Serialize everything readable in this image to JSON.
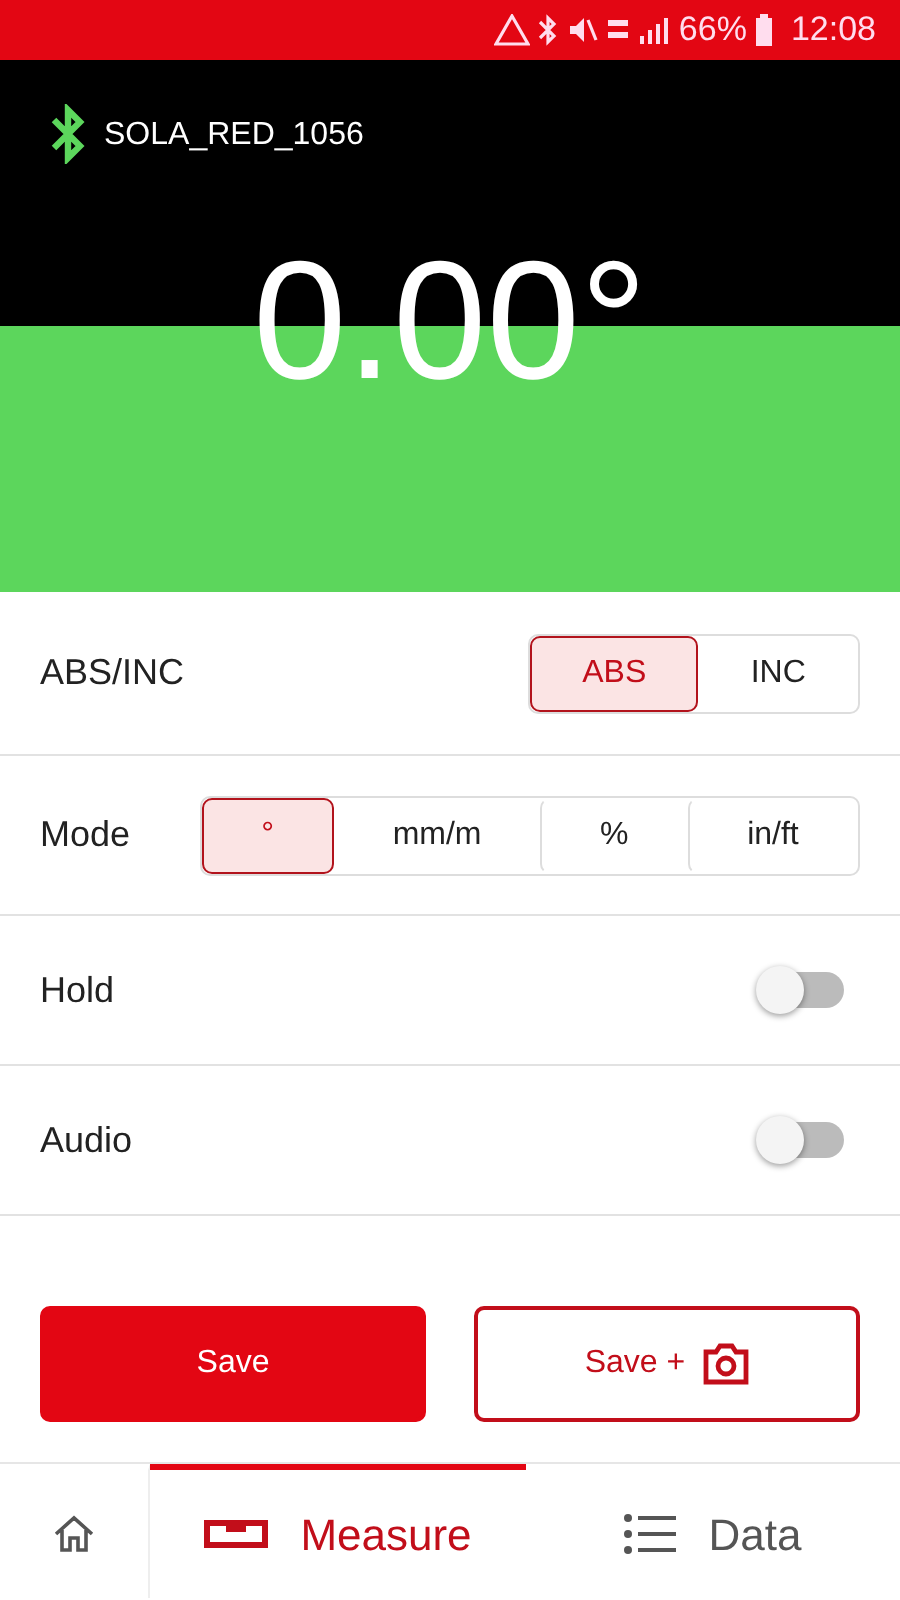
{
  "status_bar": {
    "battery": "66%",
    "time": "12:08"
  },
  "device": {
    "name": "SOLA_RED_1056",
    "connected": true
  },
  "reading": "0.00°",
  "settings": [
    {
      "kind": "segments",
      "label": "ABS/INC",
      "options": [
        {
          "label": "ABS",
          "selected": true
        },
        {
          "label": "INC",
          "selected": false
        }
      ]
    },
    {
      "kind": "segments",
      "label": "Mode",
      "options": [
        {
          "label": "°",
          "selected": true
        },
        {
          "label": "mm/m",
          "selected": false
        },
        {
          "label": "%",
          "selected": false
        },
        {
          "label": "in/ft",
          "selected": false
        }
      ]
    },
    {
      "kind": "toggle",
      "label": "Hold",
      "on": false
    },
    {
      "kind": "toggle",
      "label": "Audio",
      "on": false
    }
  ],
  "buttons": [
    {
      "kind": "primary",
      "label": "Save"
    },
    {
      "kind": "camera",
      "label": "Save +"
    }
  ],
  "nav": [
    {
      "kind": "home",
      "selected": false
    },
    {
      "kind": "measure",
      "label": "Measure",
      "selected": true
    },
    {
      "kind": "data",
      "label": "Data",
      "selected": false
    }
  ]
}
